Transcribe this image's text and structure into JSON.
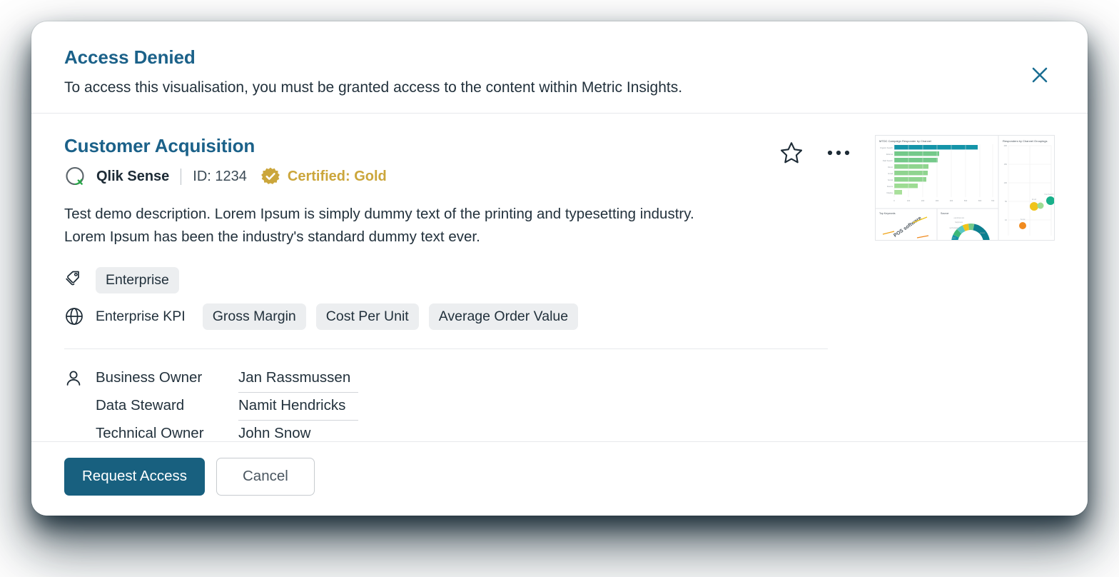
{
  "dialog": {
    "title": "Access Denied",
    "subtitle": "To access this visualisation, you must be granted access to the content within Metric Insights.",
    "close_icon": "close-icon"
  },
  "asset": {
    "name": "Customer Acquisition",
    "source": "Qlik Sense",
    "id_label": "ID: 1234",
    "certification": "Certified: Gold",
    "certification_color": "#cba63b",
    "title_color": "#1b6189",
    "description": "Test demo description. Lorem Ipsum is simply dummy text of the printing and typesetting industry. Lorem Ipsum has been the industry's standard dummy text ever."
  },
  "actions": {
    "favorite_icon": "star-outline-icon",
    "more_icon": "ellipsis-icon"
  },
  "tags": {
    "tag_row_icon": "tags-icon",
    "tag_chips": [
      "Enterprise"
    ],
    "kpi_row_icon": "globe-icon",
    "kpi_label": "Enterprise KPI",
    "kpi_chips": [
      "Gross Margin",
      "Cost Per Unit",
      "Average Order Value"
    ]
  },
  "owners": {
    "person_icon": "person-icon",
    "rows": [
      {
        "label": "Business Owner",
        "value": "Jan Rassmussen"
      },
      {
        "label": "Data Steward",
        "value": "Namit Hendricks"
      },
      {
        "label": "Technical Owner",
        "value": "John Snow"
      }
    ]
  },
  "footer": {
    "primary_label": "Request Access",
    "secondary_label": "Cancel",
    "primary_color": "#18607f"
  },
  "thumbnail": {
    "alt": "dashboard-preview",
    "panels": [
      {
        "title": "MTDC Campaign Responder by Channel",
        "type": "bar"
      },
      {
        "title": "Responders by Channel Groupings",
        "type": "scatter"
      },
      {
        "title": "Top Keywords",
        "type": "wordcloud"
      },
      {
        "title": "Source",
        "type": "donut"
      }
    ],
    "bar_values": [
      100,
      54,
      52,
      41,
      40,
      38,
      28,
      9
    ],
    "bar_colors": [
      "#1494a8",
      "#74c98a",
      "#74c98a",
      "#8fd48f",
      "#8fd48f",
      "#8fd48f",
      "#9ddc93",
      "#a8e09a"
    ]
  }
}
